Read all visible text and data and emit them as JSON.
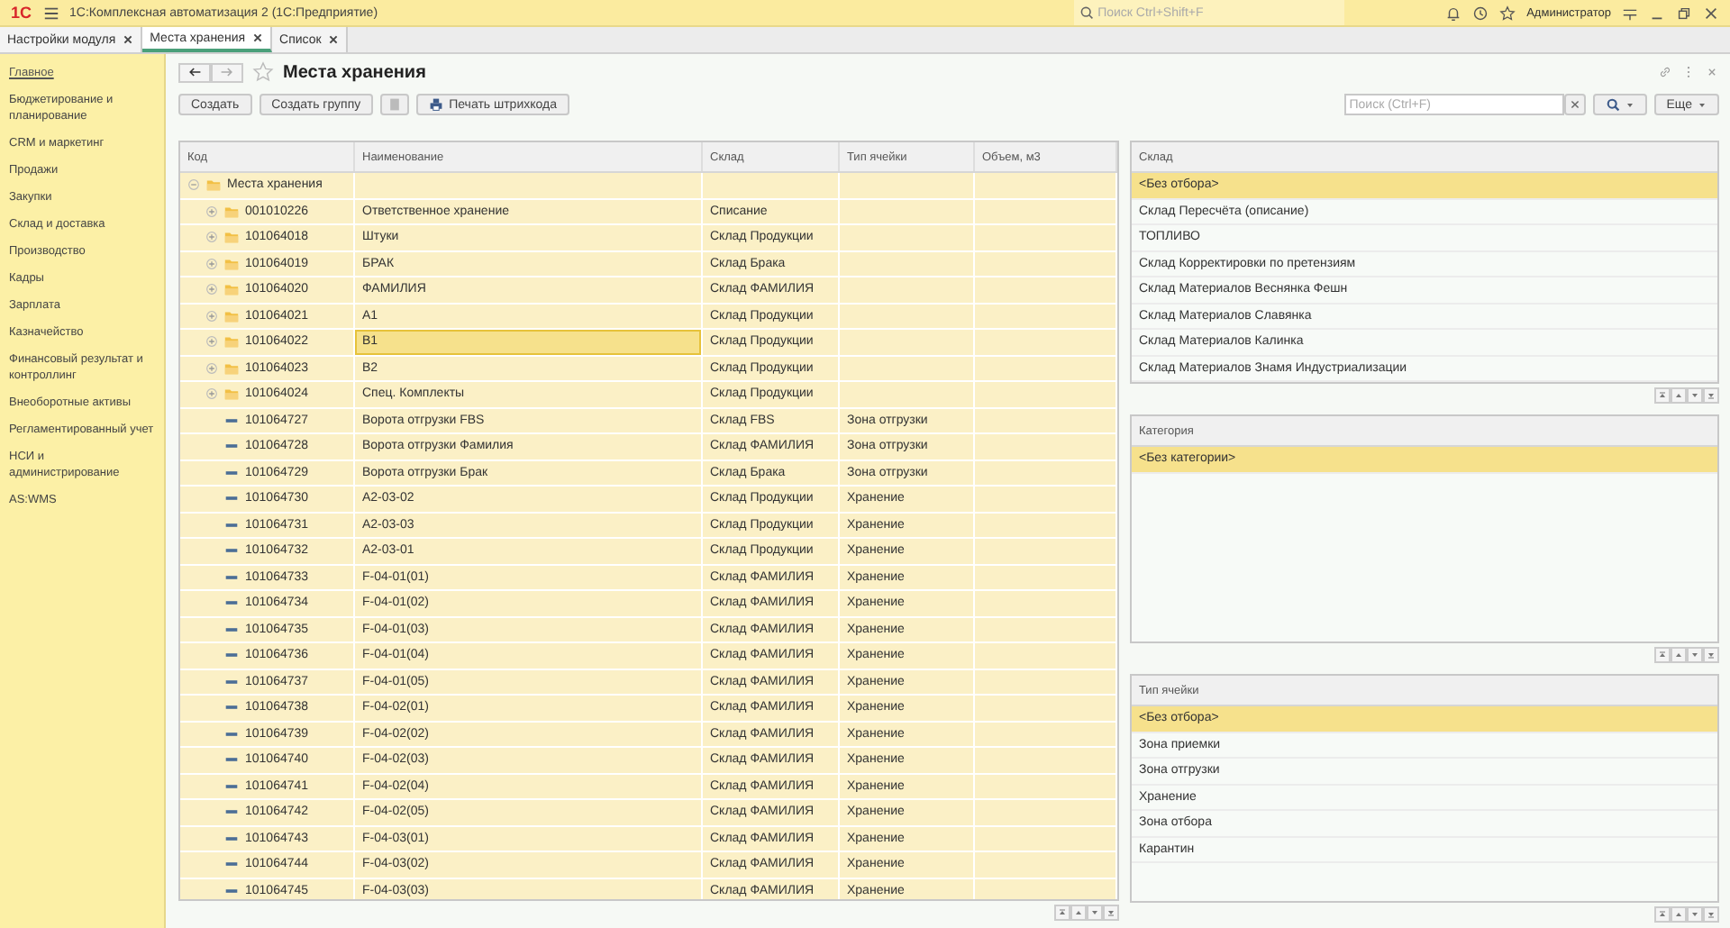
{
  "app": {
    "logo": "1С",
    "title": "1С:Комплексная автоматизация 2  (1С:Предприятие)",
    "search_placeholder": "Поиск Ctrl+Shift+F",
    "user": "Администратор"
  },
  "tabs": [
    {
      "label": "Настройки модуля",
      "selected": false
    },
    {
      "label": "Места хранения",
      "selected": true
    },
    {
      "label": "Список",
      "selected": false
    }
  ],
  "sidebar": {
    "items": [
      {
        "label": "Главное",
        "selected": true
      },
      {
        "label": "Бюджетирование и планирование",
        "selected": false
      },
      {
        "label": "CRM и маркетинг",
        "selected": false
      },
      {
        "label": "Продажи",
        "selected": false
      },
      {
        "label": "Закупки",
        "selected": false
      },
      {
        "label": "Склад и доставка",
        "selected": false
      },
      {
        "label": "Производство",
        "selected": false
      },
      {
        "label": "Кадры",
        "selected": false
      },
      {
        "label": "Зарплата",
        "selected": false
      },
      {
        "label": "Казначейство",
        "selected": false
      },
      {
        "label": "Финансовый результат и контроллинг",
        "selected": false
      },
      {
        "label": "Внеоборотные активы",
        "selected": false
      },
      {
        "label": "Регламентированный учет",
        "selected": false
      },
      {
        "label": "НСИ и администрирование",
        "selected": false
      },
      {
        "label": "AS:WMS",
        "selected": false
      }
    ]
  },
  "form": {
    "title": "Места хранения",
    "buttons": [
      "Создать",
      "Создать группу"
    ],
    "print_button": "Печать штрихкода",
    "search_placeholder": "Поиск (Ctrl+F)",
    "more_button": "Еще"
  },
  "table": {
    "columns": [
      "Код",
      "Наименование",
      "Склад",
      "Тип ячейки",
      "Объем, м3"
    ],
    "rows": [
      {
        "kind": "group",
        "code": "Места хранения",
        "expanded": true,
        "selected": false,
        "children": [
          {
            "kind": "group",
            "code": "001010226",
            "name": "Ответственное хранение",
            "warehouse": "Списание",
            "expanded": false,
            "selected": false
          },
          {
            "kind": "group",
            "code": "101064018",
            "name": "Штуки",
            "warehouse": "Склад Продукции",
            "expanded": false,
            "selected": false
          },
          {
            "kind": "group",
            "code": "101064019",
            "name": "БРАК",
            "warehouse": "Склад Брака",
            "expanded": false,
            "selected": false
          },
          {
            "kind": "group",
            "code": "101064020",
            "name": "ФАМИЛИЯ",
            "warehouse": "Склад ФАМИЛИЯ",
            "expanded": false,
            "selected": false
          },
          {
            "kind": "group",
            "code": "101064021",
            "name": "A1",
            "warehouse": "Склад Продукции",
            "expanded": false,
            "selected": false
          },
          {
            "kind": "group",
            "code": "101064022",
            "name": "B1",
            "warehouse": "Склад Продукции",
            "expanded": false,
            "selected": true
          },
          {
            "kind": "group",
            "code": "101064023",
            "name": "B2",
            "warehouse": "Склад Продукции",
            "expanded": false,
            "selected": false
          },
          {
            "kind": "group",
            "code": "101064024",
            "name": "Спец. Комплекты",
            "warehouse": "Склад Продукции",
            "expanded": false,
            "selected": false
          },
          {
            "kind": "item",
            "code": "101064727",
            "name": "Ворота отгрузки FBS",
            "warehouse": "Склад FBS",
            "cell_type": "Зона отгрузки",
            "selected": false
          },
          {
            "kind": "item",
            "code": "101064728",
            "name": "Ворота отгрузки Фамилия",
            "warehouse": "Склад ФАМИЛИЯ",
            "cell_type": "Зона отгрузки",
            "selected": false
          },
          {
            "kind": "item",
            "code": "101064729",
            "name": "Ворота отгрузки Брак",
            "warehouse": "Склад Брака",
            "cell_type": "Зона отгрузки",
            "selected": false
          },
          {
            "kind": "item",
            "code": "101064730",
            "name": "A2-03-02",
            "warehouse": "Склад Продукции",
            "cell_type": "Хранение",
            "selected": false
          },
          {
            "kind": "item",
            "code": "101064731",
            "name": "A2-03-03",
            "warehouse": "Склад Продукции",
            "cell_type": "Хранение",
            "selected": false
          },
          {
            "kind": "item",
            "code": "101064732",
            "name": "A2-03-01",
            "warehouse": "Склад Продукции",
            "cell_type": "Хранение",
            "selected": false
          },
          {
            "kind": "item",
            "code": "101064733",
            "name": "F-04-01(01)",
            "warehouse": "Склад ФАМИЛИЯ",
            "cell_type": "Хранение",
            "selected": false
          },
          {
            "kind": "item",
            "code": "101064734",
            "name": "F-04-01(02)",
            "warehouse": "Склад ФАМИЛИЯ",
            "cell_type": "Хранение",
            "selected": false
          },
          {
            "kind": "item",
            "code": "101064735",
            "name": "F-04-01(03)",
            "warehouse": "Склад ФАМИЛИЯ",
            "cell_type": "Хранение",
            "selected": false
          },
          {
            "kind": "item",
            "code": "101064736",
            "name": "F-04-01(04)",
            "warehouse": "Склад ФАМИЛИЯ",
            "cell_type": "Хранение",
            "selected": false
          },
          {
            "kind": "item",
            "code": "101064737",
            "name": "F-04-01(05)",
            "warehouse": "Склад ФАМИЛИЯ",
            "cell_type": "Хранение",
            "selected": false
          },
          {
            "kind": "item",
            "code": "101064738",
            "name": "F-04-02(01)",
            "warehouse": "Склад ФАМИЛИЯ",
            "cell_type": "Хранение",
            "selected": false
          },
          {
            "kind": "item",
            "code": "101064739",
            "name": "F-04-02(02)",
            "warehouse": "Склад ФАМИЛИЯ",
            "cell_type": "Хранение",
            "selected": false
          },
          {
            "kind": "item",
            "code": "101064740",
            "name": "F-04-02(03)",
            "warehouse": "Склад ФАМИЛИЯ",
            "cell_type": "Хранение",
            "selected": false
          },
          {
            "kind": "item",
            "code": "101064741",
            "name": "F-04-02(04)",
            "warehouse": "Склад ФАМИЛИЯ",
            "cell_type": "Хранение",
            "selected": false
          },
          {
            "kind": "item",
            "code": "101064742",
            "name": "F-04-02(05)",
            "warehouse": "Склад ФАМИЛИЯ",
            "cell_type": "Хранение",
            "selected": false
          },
          {
            "kind": "item",
            "code": "101064743",
            "name": "F-04-03(01)",
            "warehouse": "Склад ФАМИЛИЯ",
            "cell_type": "Хранение",
            "selected": false
          },
          {
            "kind": "item",
            "code": "101064744",
            "name": "F-04-03(02)",
            "warehouse": "Склад ФАМИЛИЯ",
            "cell_type": "Хранение",
            "selected": false
          },
          {
            "kind": "item",
            "code": "101064745",
            "name": "F-04-03(03)",
            "warehouse": "Склад ФАМИЛИЯ",
            "cell_type": "Хранение",
            "selected": false
          }
        ]
      }
    ]
  },
  "filters": [
    {
      "title": "Склад",
      "items": [
        {
          "label": "<Без отбора>",
          "selected": true
        },
        {
          "label": "Склад Пересчёта (описание)",
          "selected": false
        },
        {
          "label": "ТОПЛИВО",
          "selected": false
        },
        {
          "label": "Склад Корректировки по претензиям",
          "selected": false
        },
        {
          "label": "Склад Материалов Веснянка Фешн",
          "selected": false
        },
        {
          "label": "Склад Материалов Славянка",
          "selected": false
        },
        {
          "label": "Склад Материалов Калинка",
          "selected": false
        },
        {
          "label": "Склад Материалов Знамя Индустриализации",
          "selected": false
        }
      ]
    },
    {
      "title": "Категория",
      "items": [
        {
          "label": "<Без категории>",
          "selected": true
        }
      ]
    },
    {
      "title": "Тип ячейки",
      "items": [
        {
          "label": "<Без отбора>",
          "selected": true
        },
        {
          "label": "Зона приемки",
          "selected": false
        },
        {
          "label": "Зона отгрузки",
          "selected": false
        },
        {
          "label": "Хранение",
          "selected": false
        },
        {
          "label": "Зона отбора",
          "selected": false
        },
        {
          "label": "Карантин",
          "selected": false
        }
      ]
    }
  ]
}
